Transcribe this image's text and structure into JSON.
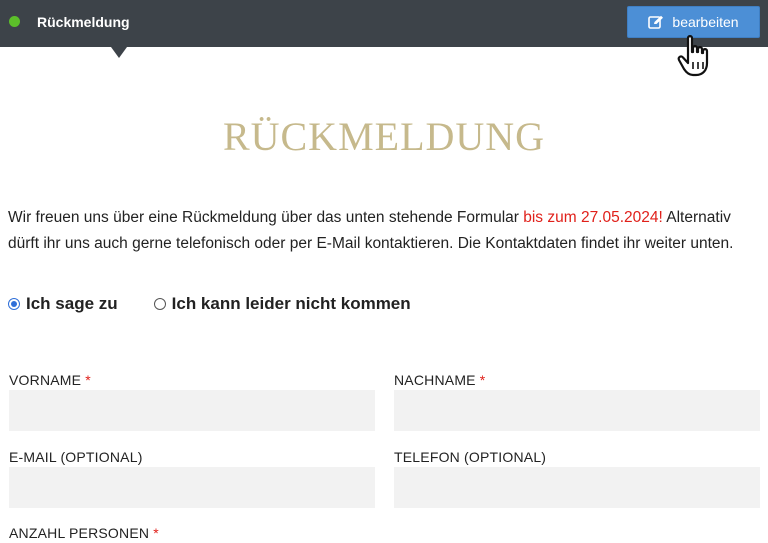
{
  "toolbar": {
    "section_name": "Rückmeldung",
    "edit_label": "bearbeiten",
    "colors": {
      "bar": "#3d4349",
      "status_dot": "#5cbf2a",
      "edit_button": "#4c8fd6"
    },
    "icons": {
      "status": "status-dot-icon",
      "edit": "edit-icon",
      "cursor": "hand-pointer-icon"
    }
  },
  "page": {
    "title": "RÜCKMELDUNG",
    "intro_before": "Wir freuen uns über eine Rückmeldung über das unten stehende Formular ",
    "intro_deadline": "bis zum 27.05.2024!",
    "intro_after": " Alternativ dürft ihr uns auch gerne telefonisch oder per E-Mail kontaktieren. Die Kontaktdaten findet ihr weiter unten.",
    "colors": {
      "title": "#c6b98c",
      "deadline": "#e0201a",
      "required": "#e0201a"
    }
  },
  "rsvp": {
    "options": [
      {
        "label": "Ich sage zu",
        "checked": true
      },
      {
        "label": "Ich kann leider nicht kommen",
        "checked": false
      }
    ]
  },
  "form": {
    "required_mark": "*",
    "fields": {
      "first_name": {
        "label": "VORNAME",
        "value": ""
      },
      "last_name": {
        "label": "NACHNAME",
        "value": ""
      },
      "email": {
        "label": "E-MAIL (OPTIONAL)",
        "value": ""
      },
      "phone": {
        "label": "TELEFON (OPTIONAL)",
        "value": ""
      },
      "persons": {
        "label": "ANZAHL PERSONEN"
      }
    }
  }
}
